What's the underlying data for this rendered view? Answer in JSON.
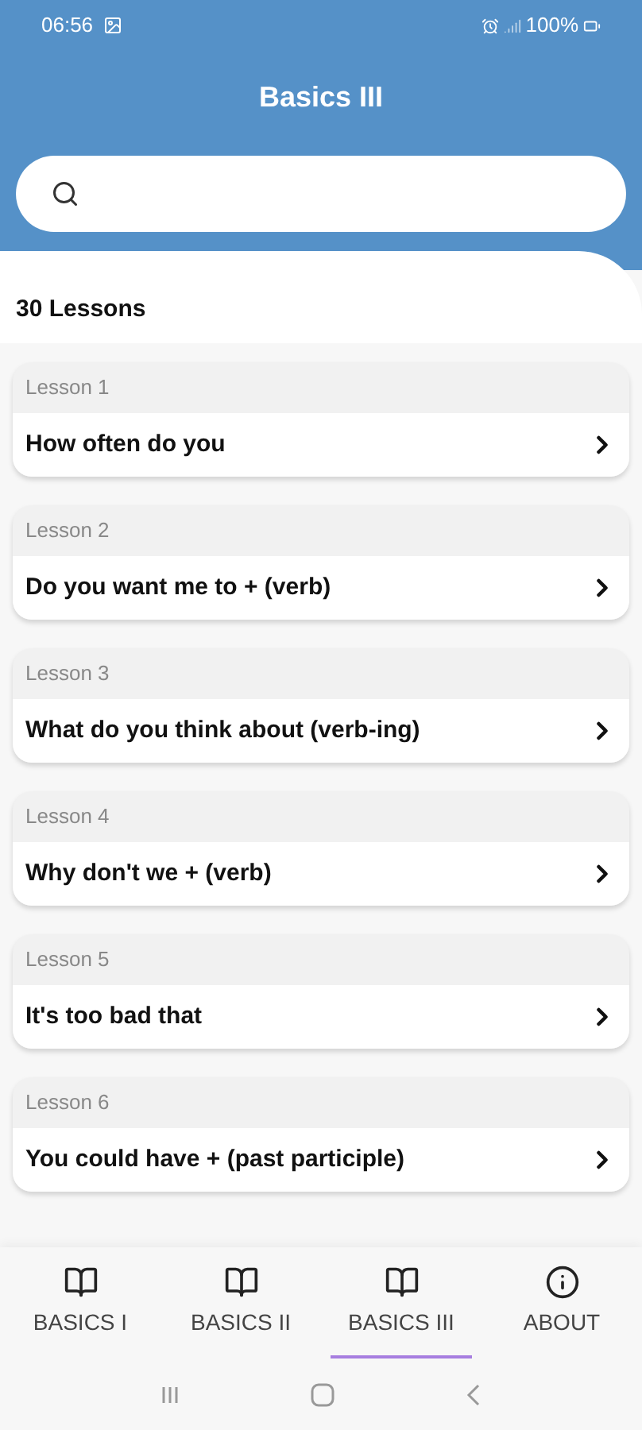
{
  "status_bar": {
    "time": "06:56",
    "battery": "100%"
  },
  "header": {
    "title": "Basics III"
  },
  "lesson_count": "30 Lessons",
  "lessons": [
    {
      "label": "Lesson 1",
      "title": "How often do you"
    },
    {
      "label": "Lesson 2",
      "title": "Do you want me to + (verb)"
    },
    {
      "label": "Lesson 3",
      "title": "What do you think about (verb-ing)"
    },
    {
      "label": "Lesson 4",
      "title": "Why don't we + (verb)"
    },
    {
      "label": "Lesson 5",
      "title": "It's too bad that"
    },
    {
      "label": "Lesson 6",
      "title": "You could have + (past participle)"
    }
  ],
  "tabs": [
    {
      "label": "BASICS I",
      "kind": "book",
      "selected": false
    },
    {
      "label": "BASICS II",
      "kind": "book",
      "selected": false
    },
    {
      "label": "BASICS III",
      "kind": "book",
      "selected": true
    },
    {
      "label": "ABOUT",
      "kind": "info",
      "selected": false
    }
  ]
}
